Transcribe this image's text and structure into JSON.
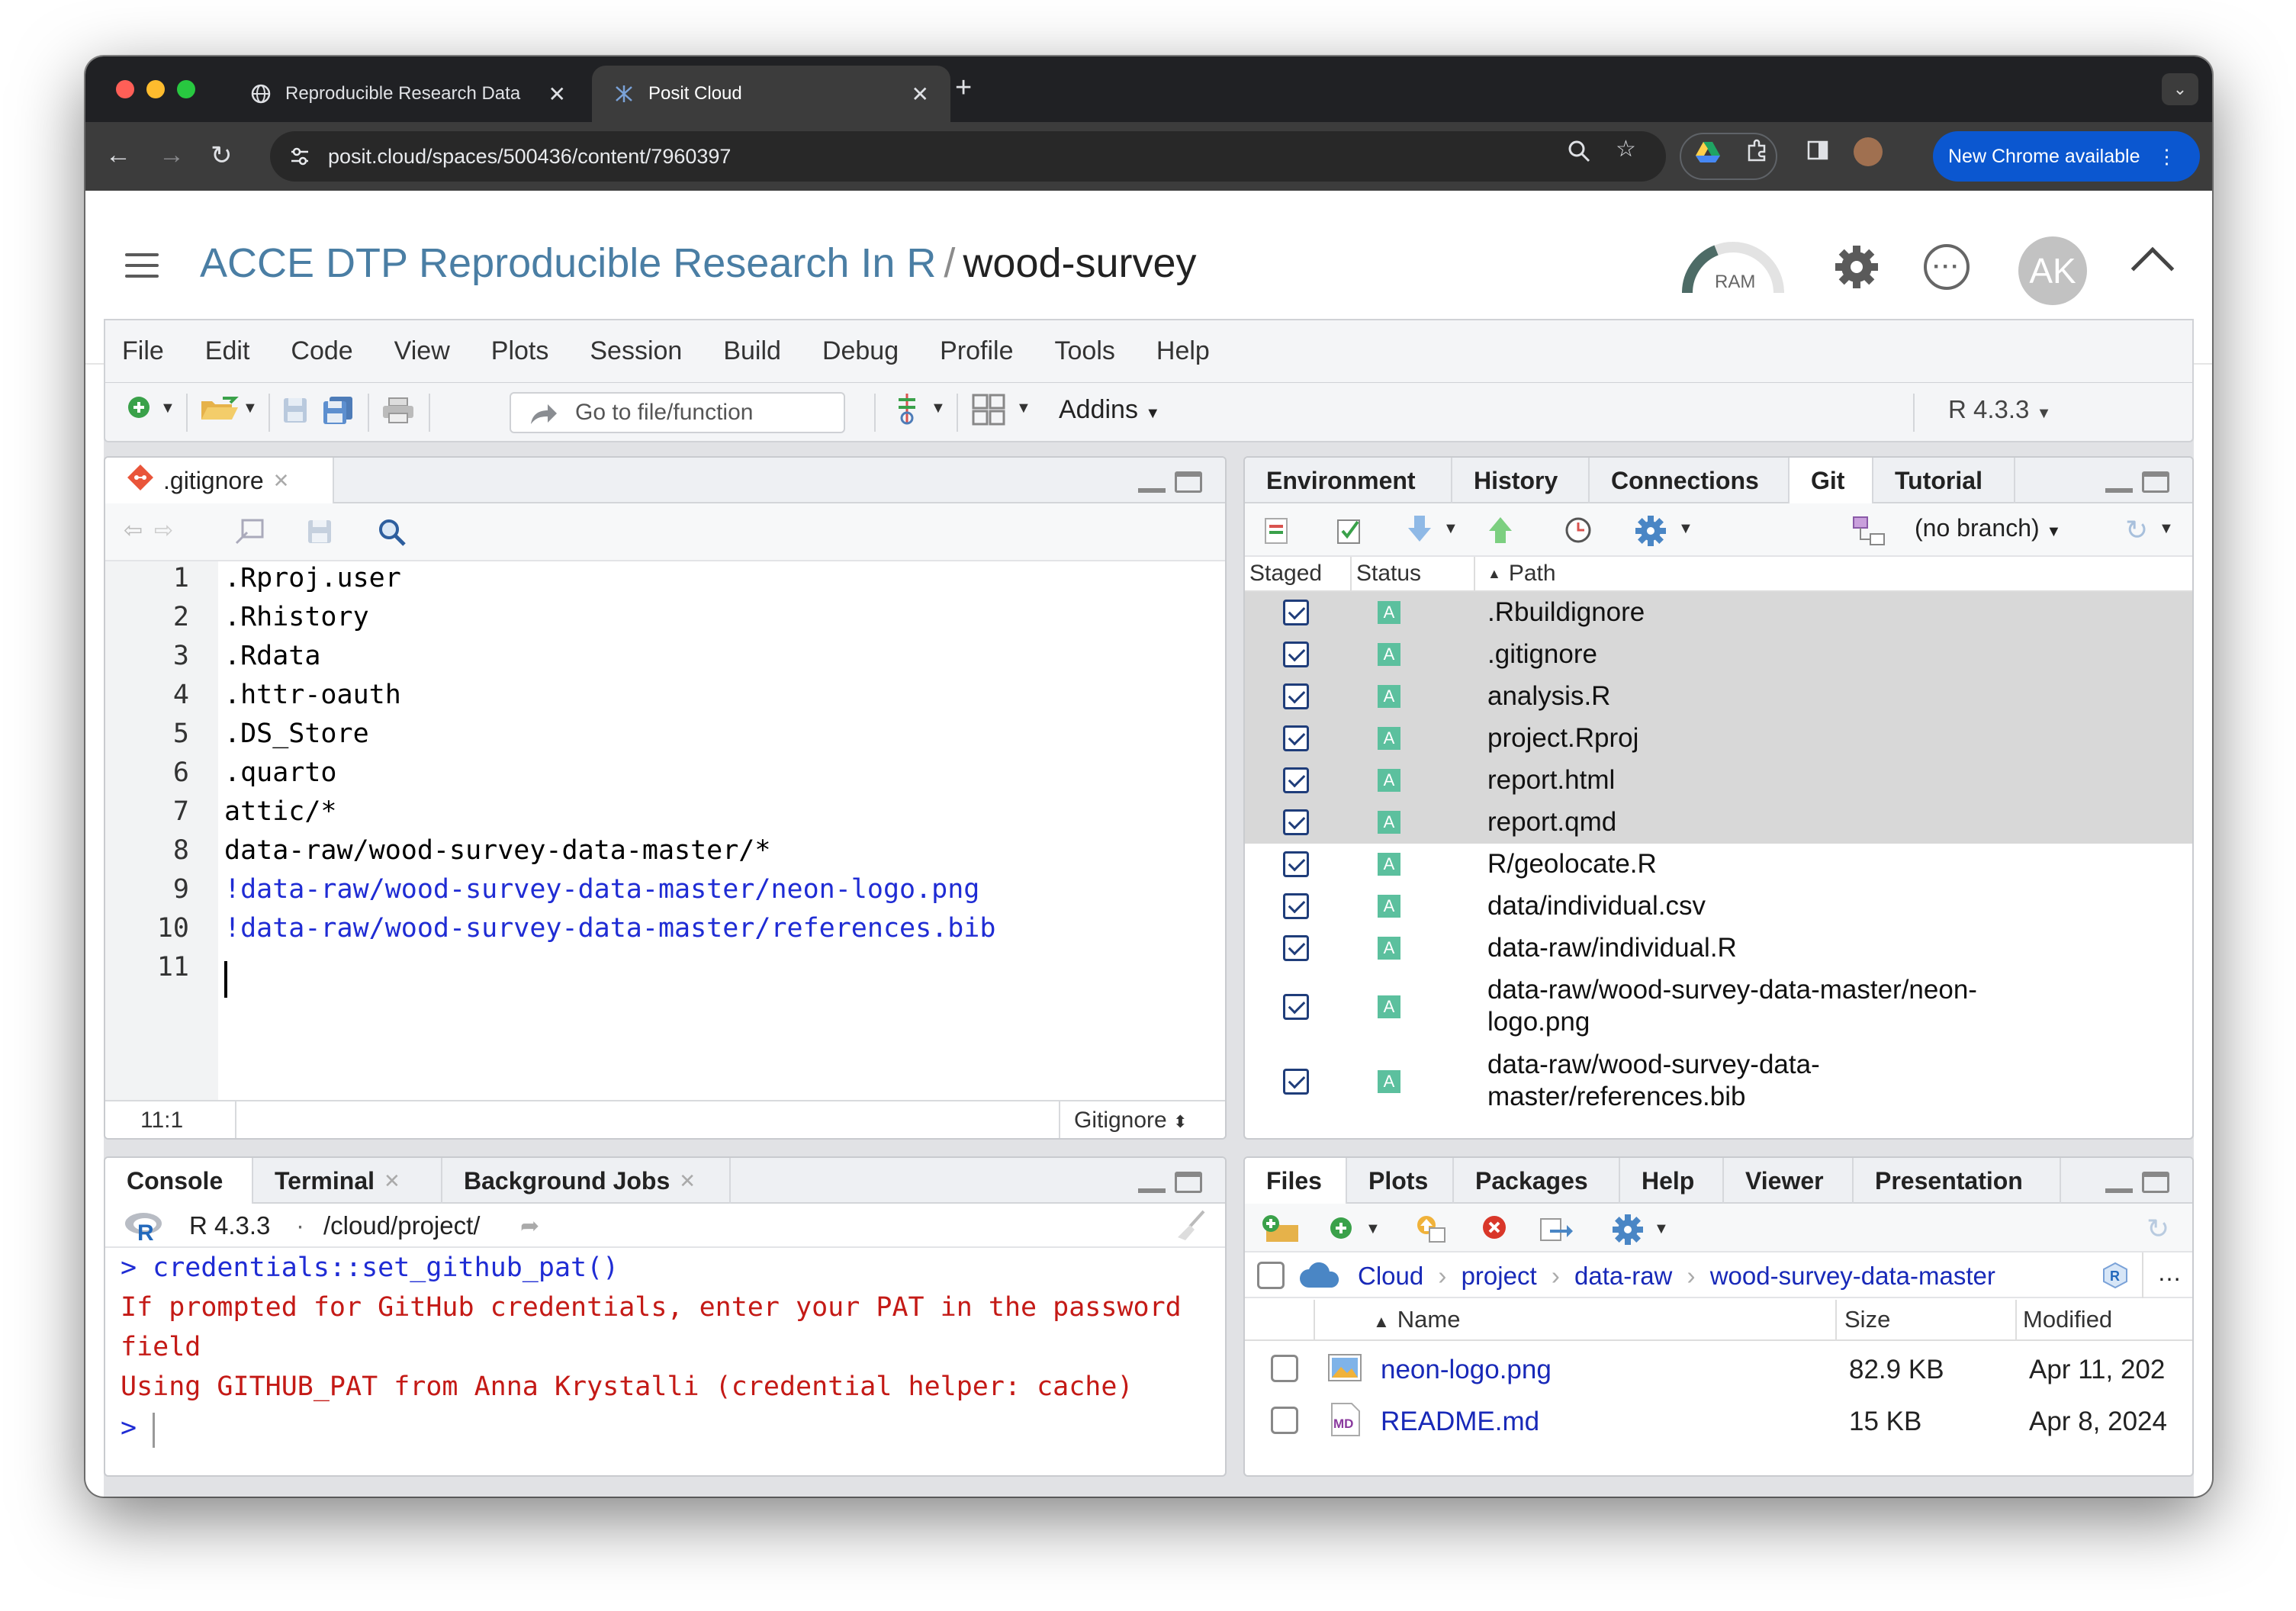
{
  "browser": {
    "tabs": [
      {
        "title": "Reproducible Research Data",
        "active": false
      },
      {
        "title": "Posit Cloud",
        "active": true
      }
    ],
    "url": "posit.cloud/spaces/500436/content/7960397",
    "new_chrome_label": "New Chrome available"
  },
  "posit": {
    "breadcrumb_space": "ACCE DTP Reproducible Research In R",
    "breadcrumb_sep": "/",
    "project": "wood-survey",
    "ram_label": "RAM",
    "avatar_initials": "AK"
  },
  "menu": [
    "File",
    "Edit",
    "Code",
    "View",
    "Plots",
    "Session",
    "Build",
    "Debug",
    "Profile",
    "Tools",
    "Help"
  ],
  "toolbar": {
    "goto_placeholder": "Go to file/function",
    "addins_label": "Addins",
    "r_version": "R 4.3.3"
  },
  "editor": {
    "tab_name": ".gitignore",
    "lines": [
      {
        "n": "1",
        "text": ".Rproj.user",
        "neg": false
      },
      {
        "n": "2",
        "text": ".Rhistory",
        "neg": false
      },
      {
        "n": "3",
        "text": ".Rdata",
        "neg": false
      },
      {
        "n": "4",
        "text": ".httr-oauth",
        "neg": false
      },
      {
        "n": "5",
        "text": ".DS_Store",
        "neg": false
      },
      {
        "n": "6",
        "text": ".quarto",
        "neg": false
      },
      {
        "n": "7",
        "text": "attic/*",
        "neg": false
      },
      {
        "n": "8",
        "text": "data-raw/wood-survey-data-master/*",
        "neg": false
      },
      {
        "n": "9",
        "text": "!data-raw/wood-survey-data-master/neon-logo.png",
        "neg": true
      },
      {
        "n": "10",
        "text": "!data-raw/wood-survey-data-master/references.bib",
        "neg": true
      },
      {
        "n": "11",
        "text": "",
        "neg": false
      }
    ],
    "cursor_pos": "11:1",
    "file_type": "Gitignore"
  },
  "env_pane": {
    "tabs": [
      "Environment",
      "History",
      "Connections",
      "Git",
      "Tutorial"
    ],
    "active_tab": "Git",
    "branch": "(no branch)",
    "headers": {
      "staged": "Staged",
      "status": "Status",
      "path": "Path"
    },
    "rows": [
      {
        "path": ".Rbuildignore",
        "status": "A",
        "selected": true
      },
      {
        "path": ".gitignore",
        "status": "A",
        "selected": true
      },
      {
        "path": "analysis.R",
        "status": "A",
        "selected": true
      },
      {
        "path": "project.Rproj",
        "status": "A",
        "selected": true
      },
      {
        "path": "report.html",
        "status": "A",
        "selected": true
      },
      {
        "path": "report.qmd",
        "status": "A",
        "selected": true
      },
      {
        "path": "R/geolocate.R",
        "status": "A",
        "selected": false
      },
      {
        "path": "data/individual.csv",
        "status": "A",
        "selected": false
      },
      {
        "path": "data-raw/individual.R",
        "status": "A",
        "selected": false
      },
      {
        "path": "data-raw/wood-survey-data-master/neon-logo.png",
        "path_l1": "data-raw/wood-survey-data-master/neon-",
        "path_l2": "logo.png",
        "status": "A",
        "selected": false
      },
      {
        "path": "data-raw/wood-survey-data-master/references.bib",
        "path_l1": "data-raw/wood-survey-data-",
        "path_l2": "master/references.bib",
        "status": "A",
        "selected": false
      }
    ]
  },
  "console": {
    "tabs": [
      "Console",
      "Terminal",
      "Background Jobs"
    ],
    "r_version": "R 4.3.3",
    "dot": "·",
    "wd": "/cloud/project/",
    "lines": [
      {
        "text": "> credentials::set_github_pat()",
        "kind": "input"
      },
      {
        "text": "If prompted for GitHub credentials, enter your PAT in the password",
        "kind": "output"
      },
      {
        "text": "field",
        "kind": "output"
      },
      {
        "text": "Using GITHUB_PAT from Anna Krystalli (credential helper: cache)",
        "kind": "output"
      },
      {
        "text": ">",
        "kind": "prompt"
      }
    ]
  },
  "files_pane": {
    "tabs": [
      "Files",
      "Plots",
      "Packages",
      "Help",
      "Viewer",
      "Presentation"
    ],
    "breadcrumb": [
      "Cloud",
      "project",
      "data-raw",
      "wood-survey-data-master"
    ],
    "headers": {
      "name": "Name",
      "size": "Size",
      "modified": "Modified"
    },
    "rows": [
      {
        "name": "neon-logo.png",
        "size": "82.9 KB",
        "modified": "Apr 11, 202",
        "icon": "image-file-icon"
      },
      {
        "name": "README.md",
        "size": "15 KB",
        "modified": "Apr 8, 2024",
        "icon": "markdown-file-icon"
      }
    ]
  }
}
